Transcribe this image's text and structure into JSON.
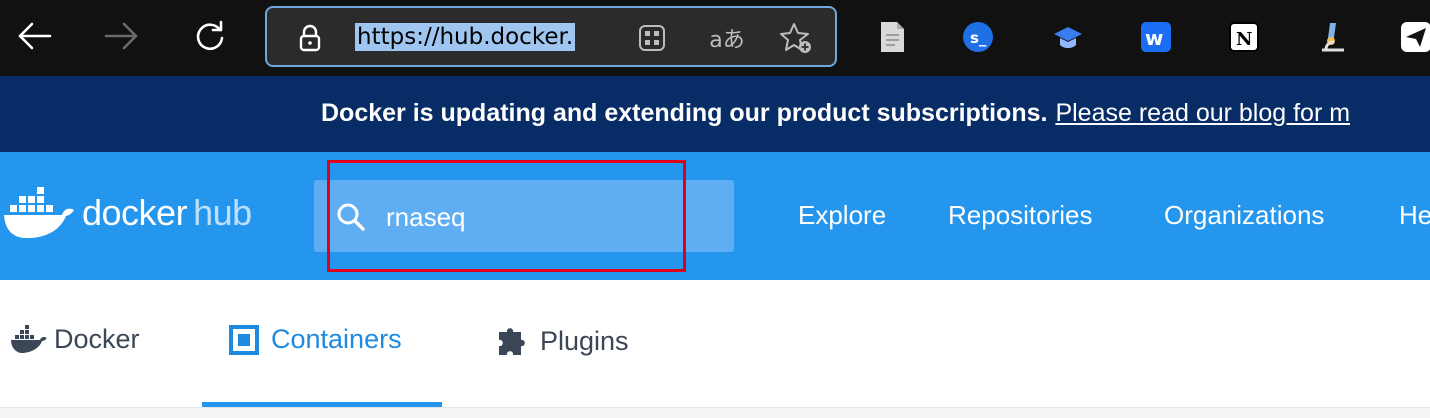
{
  "browser": {
    "url": "https://hub.docker.",
    "icons": [
      "back-arrow-icon",
      "forward-arrow-icon",
      "refresh-icon",
      "lock-icon",
      "app-grid-icon",
      "translate-icon",
      "add-favorite-icon"
    ],
    "translate_glyph": "aあ",
    "extensions": [
      "document-icon",
      "s-badge-icon",
      "graduation-cap-icon",
      "w-app-icon",
      "notion-icon",
      "microscope-icon",
      "send-icon"
    ]
  },
  "banner": {
    "text": "Docker is updating and extending our product subscriptions.",
    "link": "Please read our blog for m"
  },
  "header": {
    "logo_docker": "docker",
    "logo_hub": "hub",
    "search_value": "rnaseq",
    "nav": [
      "Explore",
      "Repositories",
      "Organizations",
      "He"
    ]
  },
  "tabs": [
    {
      "label": "Docker",
      "icon": "whale-icon",
      "active": false
    },
    {
      "label": "Containers",
      "icon": "container-icon",
      "active": true
    },
    {
      "label": "Plugins",
      "icon": "puzzle-icon",
      "active": false
    }
  ],
  "colors": {
    "banner_bg": "#072c66",
    "header_bg": "#2496ed",
    "active_tab": "#1f8ae0",
    "highlight": "#e0001b"
  }
}
